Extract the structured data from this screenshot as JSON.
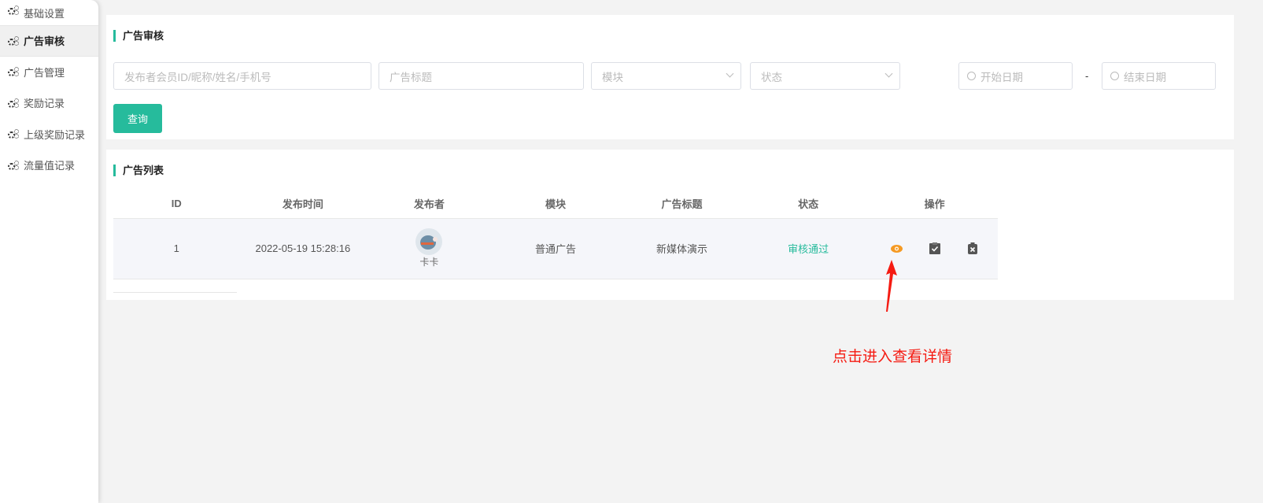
{
  "sidebar": {
    "items": [
      {
        "label": "基础设置"
      },
      {
        "label": "广告审核",
        "active": true
      },
      {
        "label": "广告管理"
      },
      {
        "label": "奖励记录"
      },
      {
        "label": "上级奖励记录"
      },
      {
        "label": "流量值记录"
      }
    ]
  },
  "filter": {
    "title": "广告审核",
    "publisher_placeholder": "发布者会员ID/昵称/姓名/手机号",
    "ad_title_placeholder": "广告标题",
    "module_placeholder": "模块",
    "status_placeholder": "状态",
    "start_date_placeholder": "开始日期",
    "separator": "-",
    "end_date_placeholder": "结束日期",
    "query_label": "查询"
  },
  "list": {
    "title": "广告列表",
    "columns": [
      "ID",
      "发布时间",
      "发布者",
      "模块",
      "广告标题",
      "状态",
      "操作"
    ],
    "rows": [
      {
        "id": "1",
        "time": "2022-05-19 15:28:16",
        "publisher": "卡卡",
        "module": "普通广告",
        "ad_title": "新媒体演示",
        "status": "审核通过"
      }
    ]
  },
  "colors": {
    "accent": "#26bb9c",
    "view": "#f59a23",
    "annotation": "#f51b12"
  },
  "annotation": "点击进入查看详情"
}
